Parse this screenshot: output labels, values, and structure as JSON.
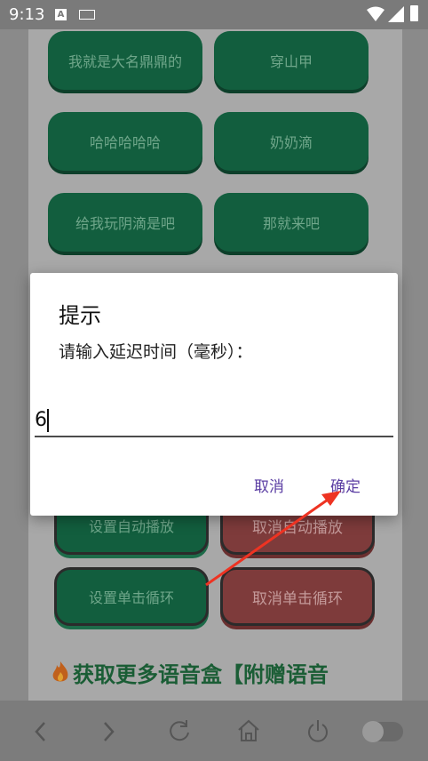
{
  "status_bar": {
    "time": "9:13",
    "notification_icon_letter": "A"
  },
  "background_buttons": {
    "row1": [
      "我就是大名鼎鼎的",
      "穿山甲"
    ],
    "row2": [
      "哈哈哈哈哈",
      "奶奶滴"
    ],
    "row3": [
      "给我玩阴滴是吧",
      "那就来吧"
    ],
    "autoplay_set": "设置自动播放",
    "autoplay_cancel": "取消自动播放",
    "loop_set": "设置单击循环",
    "loop_cancel": "取消单击循环"
  },
  "promo_text": "获取更多语音盒【附赠语音",
  "dialog": {
    "title": "提示",
    "message": "请输入延迟时间（毫秒）：",
    "input_value": "6",
    "cancel_label": "取消",
    "confirm_label": "确定"
  },
  "colors": {
    "annotation_arrow": "#ee3322",
    "dialog_button": "#5b3ea3"
  },
  "icons": [
    "back-icon",
    "forward-icon",
    "reload-icon",
    "home-icon",
    "power-icon",
    "toggle-switch"
  ]
}
